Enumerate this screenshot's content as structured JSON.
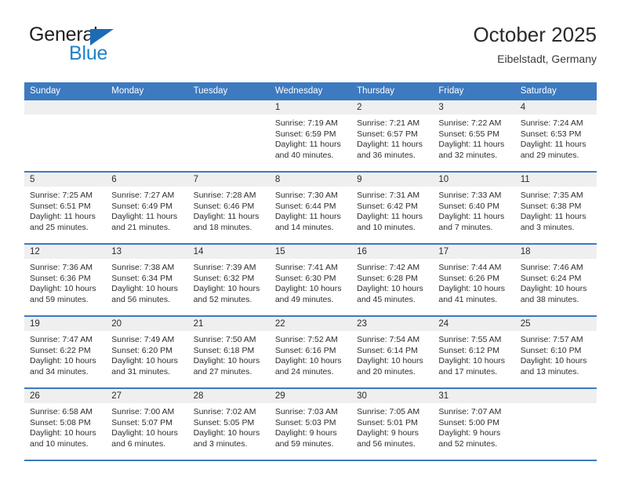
{
  "brand": {
    "name_top": "General",
    "name_bottom": "Blue",
    "accent_color": "#2083c9",
    "triangle_color": "#1b6cb5"
  },
  "header": {
    "title": "October 2025",
    "subtitle": "Eibelstadt, Germany"
  },
  "theme": {
    "header_blue": "#3d7ac0",
    "daynum_band": "#efefef",
    "text": "#2e2e2e"
  },
  "weekdays": [
    "Sunday",
    "Monday",
    "Tuesday",
    "Wednesday",
    "Thursday",
    "Friday",
    "Saturday"
  ],
  "weeks": [
    [
      {
        "day": "",
        "lines": [
          "",
          "",
          "",
          ""
        ]
      },
      {
        "day": "",
        "lines": [
          "",
          "",
          "",
          ""
        ]
      },
      {
        "day": "",
        "lines": [
          "",
          "",
          "",
          ""
        ]
      },
      {
        "day": "1",
        "lines": [
          "Sunrise: 7:19 AM",
          "Sunset: 6:59 PM",
          "Daylight: 11 hours",
          "and 40 minutes."
        ]
      },
      {
        "day": "2",
        "lines": [
          "Sunrise: 7:21 AM",
          "Sunset: 6:57 PM",
          "Daylight: 11 hours",
          "and 36 minutes."
        ]
      },
      {
        "day": "3",
        "lines": [
          "Sunrise: 7:22 AM",
          "Sunset: 6:55 PM",
          "Daylight: 11 hours",
          "and 32 minutes."
        ]
      },
      {
        "day": "4",
        "lines": [
          "Sunrise: 7:24 AM",
          "Sunset: 6:53 PM",
          "Daylight: 11 hours",
          "and 29 minutes."
        ]
      }
    ],
    [
      {
        "day": "5",
        "lines": [
          "Sunrise: 7:25 AM",
          "Sunset: 6:51 PM",
          "Daylight: 11 hours",
          "and 25 minutes."
        ]
      },
      {
        "day": "6",
        "lines": [
          "Sunrise: 7:27 AM",
          "Sunset: 6:49 PM",
          "Daylight: 11 hours",
          "and 21 minutes."
        ]
      },
      {
        "day": "7",
        "lines": [
          "Sunrise: 7:28 AM",
          "Sunset: 6:46 PM",
          "Daylight: 11 hours",
          "and 18 minutes."
        ]
      },
      {
        "day": "8",
        "lines": [
          "Sunrise: 7:30 AM",
          "Sunset: 6:44 PM",
          "Daylight: 11 hours",
          "and 14 minutes."
        ]
      },
      {
        "day": "9",
        "lines": [
          "Sunrise: 7:31 AM",
          "Sunset: 6:42 PM",
          "Daylight: 11 hours",
          "and 10 minutes."
        ]
      },
      {
        "day": "10",
        "lines": [
          "Sunrise: 7:33 AM",
          "Sunset: 6:40 PM",
          "Daylight: 11 hours",
          "and 7 minutes."
        ]
      },
      {
        "day": "11",
        "lines": [
          "Sunrise: 7:35 AM",
          "Sunset: 6:38 PM",
          "Daylight: 11 hours",
          "and 3 minutes."
        ]
      }
    ],
    [
      {
        "day": "12",
        "lines": [
          "Sunrise: 7:36 AM",
          "Sunset: 6:36 PM",
          "Daylight: 10 hours",
          "and 59 minutes."
        ]
      },
      {
        "day": "13",
        "lines": [
          "Sunrise: 7:38 AM",
          "Sunset: 6:34 PM",
          "Daylight: 10 hours",
          "and 56 minutes."
        ]
      },
      {
        "day": "14",
        "lines": [
          "Sunrise: 7:39 AM",
          "Sunset: 6:32 PM",
          "Daylight: 10 hours",
          "and 52 minutes."
        ]
      },
      {
        "day": "15",
        "lines": [
          "Sunrise: 7:41 AM",
          "Sunset: 6:30 PM",
          "Daylight: 10 hours",
          "and 49 minutes."
        ]
      },
      {
        "day": "16",
        "lines": [
          "Sunrise: 7:42 AM",
          "Sunset: 6:28 PM",
          "Daylight: 10 hours",
          "and 45 minutes."
        ]
      },
      {
        "day": "17",
        "lines": [
          "Sunrise: 7:44 AM",
          "Sunset: 6:26 PM",
          "Daylight: 10 hours",
          "and 41 minutes."
        ]
      },
      {
        "day": "18",
        "lines": [
          "Sunrise: 7:46 AM",
          "Sunset: 6:24 PM",
          "Daylight: 10 hours",
          "and 38 minutes."
        ]
      }
    ],
    [
      {
        "day": "19",
        "lines": [
          "Sunrise: 7:47 AM",
          "Sunset: 6:22 PM",
          "Daylight: 10 hours",
          "and 34 minutes."
        ]
      },
      {
        "day": "20",
        "lines": [
          "Sunrise: 7:49 AM",
          "Sunset: 6:20 PM",
          "Daylight: 10 hours",
          "and 31 minutes."
        ]
      },
      {
        "day": "21",
        "lines": [
          "Sunrise: 7:50 AM",
          "Sunset: 6:18 PM",
          "Daylight: 10 hours",
          "and 27 minutes."
        ]
      },
      {
        "day": "22",
        "lines": [
          "Sunrise: 7:52 AM",
          "Sunset: 6:16 PM",
          "Daylight: 10 hours",
          "and 24 minutes."
        ]
      },
      {
        "day": "23",
        "lines": [
          "Sunrise: 7:54 AM",
          "Sunset: 6:14 PM",
          "Daylight: 10 hours",
          "and 20 minutes."
        ]
      },
      {
        "day": "24",
        "lines": [
          "Sunrise: 7:55 AM",
          "Sunset: 6:12 PM",
          "Daylight: 10 hours",
          "and 17 minutes."
        ]
      },
      {
        "day": "25",
        "lines": [
          "Sunrise: 7:57 AM",
          "Sunset: 6:10 PM",
          "Daylight: 10 hours",
          "and 13 minutes."
        ]
      }
    ],
    [
      {
        "day": "26",
        "lines": [
          "Sunrise: 6:58 AM",
          "Sunset: 5:08 PM",
          "Daylight: 10 hours",
          "and 10 minutes."
        ]
      },
      {
        "day": "27",
        "lines": [
          "Sunrise: 7:00 AM",
          "Sunset: 5:07 PM",
          "Daylight: 10 hours",
          "and 6 minutes."
        ]
      },
      {
        "day": "28",
        "lines": [
          "Sunrise: 7:02 AM",
          "Sunset: 5:05 PM",
          "Daylight: 10 hours",
          "and 3 minutes."
        ]
      },
      {
        "day": "29",
        "lines": [
          "Sunrise: 7:03 AM",
          "Sunset: 5:03 PM",
          "Daylight: 9 hours",
          "and 59 minutes."
        ]
      },
      {
        "day": "30",
        "lines": [
          "Sunrise: 7:05 AM",
          "Sunset: 5:01 PM",
          "Daylight: 9 hours",
          "and 56 minutes."
        ]
      },
      {
        "day": "31",
        "lines": [
          "Sunrise: 7:07 AM",
          "Sunset: 5:00 PM",
          "Daylight: 9 hours",
          "and 52 minutes."
        ]
      },
      {
        "day": "",
        "lines": [
          "",
          "",
          "",
          ""
        ]
      }
    ]
  ]
}
